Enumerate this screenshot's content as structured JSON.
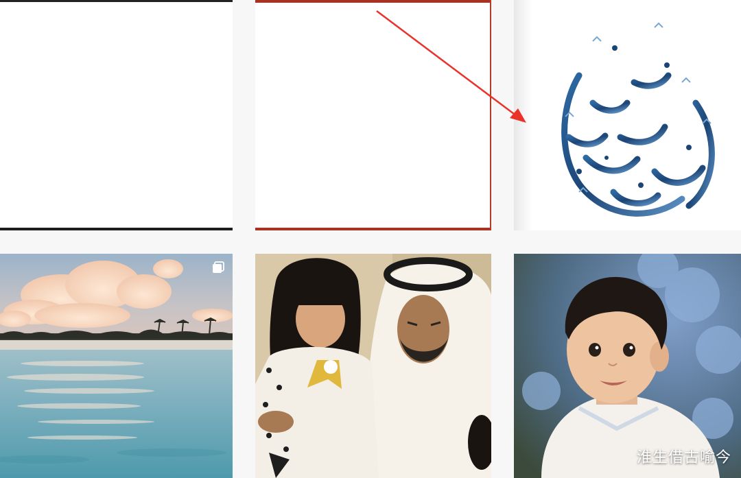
{
  "grid": {
    "posts": [
      {
        "kind": "image",
        "subject": "blank-white"
      },
      {
        "kind": "image",
        "subject": "blank-white-red-border"
      },
      {
        "kind": "image",
        "subject": "arabic-calligraphy"
      },
      {
        "kind": "carousel",
        "subject": "beach-sunset"
      },
      {
        "kind": "image",
        "subject": "man-with-girl"
      },
      {
        "kind": "image",
        "subject": "baby-boy"
      }
    ]
  },
  "colors": {
    "annotation_arrow": "#e8322a",
    "calligraphy": "#1f4a7a"
  },
  "watermark": {
    "text": "淮生借古喻今"
  }
}
